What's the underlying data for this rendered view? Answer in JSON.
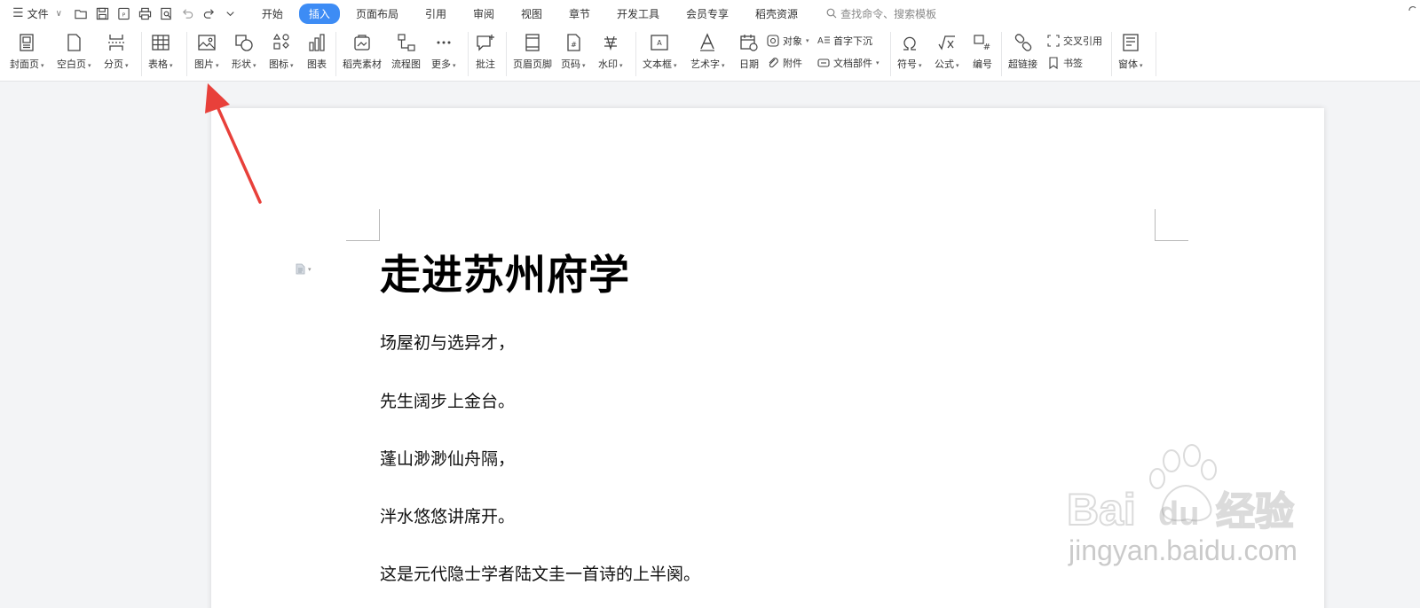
{
  "menubar": {
    "file_label": "文件",
    "tabs": [
      "开始",
      "插入",
      "页面布局",
      "引用",
      "审阅",
      "视图",
      "章节",
      "开发工具",
      "会员专享",
      "稻壳资源"
    ],
    "active_tab": "插入",
    "search_placeholder": "查找命令、搜索模板"
  },
  "ribbon": {
    "cover": "封面页",
    "blank": "空白页",
    "pagebreak": "分页",
    "table": "表格",
    "picture": "图片",
    "shape": "形状",
    "icons": "图标",
    "chart": "图表",
    "docer_material": "稻壳素材",
    "flowchart": "流程图",
    "more": "更多",
    "comment": "批注",
    "header_footer": "页眉页脚",
    "page_number": "页码",
    "watermark": "水印",
    "textbox": "文本框",
    "wordart": "艺术字",
    "date": "日期",
    "object": "对象",
    "attachment": "附件",
    "dropcap": "首字下沉",
    "doc_parts": "文档部件",
    "symbol": "符号",
    "formula": "公式",
    "numbering": "编号",
    "hyperlink": "超链接",
    "crossref": "交叉引用",
    "bookmark": "书签",
    "window": "窗体"
  },
  "document": {
    "title": "走进苏州府学",
    "paragraphs": [
      "场屋初与选异才，",
      "先生阔步上金台。",
      "蓬山渺渺仙舟隔，",
      "泮水悠悠讲席开。",
      "这是元代隐士学者陆文圭一首诗的上半阕。"
    ]
  },
  "watermark": {
    "brand": "Bai",
    "brand_du": "du",
    "brand_cn": "经验",
    "url": "jingyan.baidu.com"
  },
  "colors": {
    "accent": "#3d8cf5",
    "arrow": "#e8403a"
  }
}
